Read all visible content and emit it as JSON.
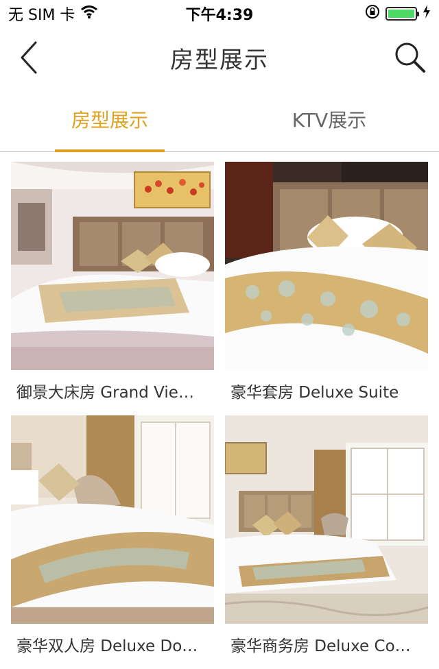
{
  "status_bar": {
    "carrier": "无 SIM 卡",
    "time": "下午4:39",
    "battery_level": 1.0,
    "icons": [
      "wifi-icon",
      "orientation-lock-icon",
      "battery-icon",
      "charging-icon"
    ]
  },
  "nav": {
    "title": "房型展示",
    "back_icon": "chevron-left-icon",
    "search_icon": "search-icon"
  },
  "tabs": [
    {
      "label": "房型展示",
      "active": true
    },
    {
      "label": "KTV展示",
      "active": false
    }
  ],
  "colors": {
    "accent": "#e0a020",
    "tab_inactive": "#666666",
    "divider": "#d9d9d9"
  },
  "rooms": [
    {
      "caption": "御景大床房 Grand Vie…"
    },
    {
      "caption": "豪华套房 Deluxe Suite"
    },
    {
      "caption": "豪华双人房  Deluxe Do…"
    },
    {
      "caption": "豪华商务房 Deluxe Co…"
    }
  ]
}
